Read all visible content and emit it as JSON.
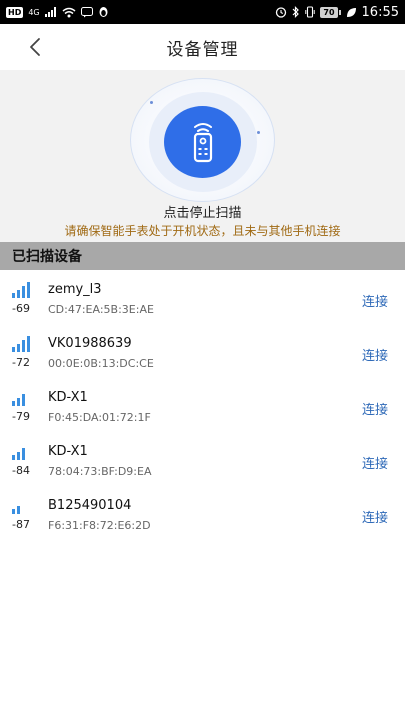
{
  "status_bar": {
    "hd": "HD",
    "network": "4G",
    "battery": "70",
    "time": "16:55",
    "icons": [
      "signal-icon",
      "wifi-icon",
      "message-icon",
      "alarm-icon",
      "bluetooth-icon",
      "leaf-icon"
    ]
  },
  "header": {
    "title": "设备管理",
    "back_icon": "chevron-left-icon"
  },
  "scan": {
    "icon": "remote-control-icon",
    "label": "点击停止扫描",
    "hint": "请确保智能手表处于开机状态，且未与其他手机连接"
  },
  "section": {
    "title": "已扫描设备"
  },
  "devices": [
    {
      "rssi": "-69",
      "bars": 4,
      "name": "zemy_l3",
      "mac": "CD:47:EA:5B:3E:AE",
      "action": "连接"
    },
    {
      "rssi": "-72",
      "bars": 4,
      "name": "VK01988639",
      "mac": "00:0E:0B:13:DC:CE",
      "action": "连接"
    },
    {
      "rssi": "-79",
      "bars": 3,
      "name": "KD-X1",
      "mac": "F0:45:DA:01:72:1F",
      "action": "连接"
    },
    {
      "rssi": "-84",
      "bars": 3,
      "name": "KD-X1",
      "mac": "78:04:73:BF:D9:EA",
      "action": "连接"
    },
    {
      "rssi": "-87",
      "bars": 2,
      "name": "B125490104",
      "mac": "F6:31:F8:72:E6:2D",
      "action": "连接"
    }
  ],
  "colors": {
    "accent": "#2f6ee8",
    "link": "#2f6ab8",
    "hint": "#a06a14",
    "section_bg": "#a8a8a8"
  }
}
